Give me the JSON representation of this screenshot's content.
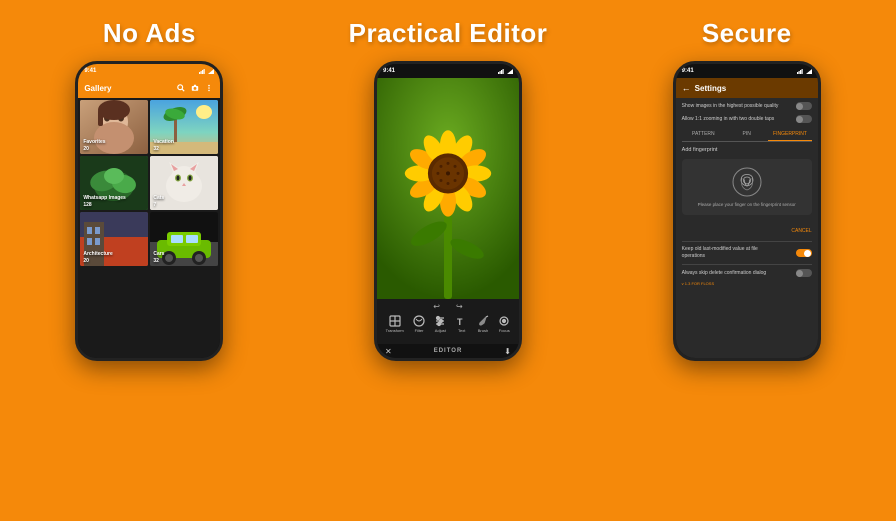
{
  "panels": [
    {
      "id": "no-ads",
      "title": "No Ads",
      "phone": {
        "time": "9:41",
        "app": "gallery",
        "toolbar": {
          "title": "Gallery"
        },
        "cells": [
          {
            "label": "Favorites",
            "count": "20",
            "type": "face"
          },
          {
            "label": "Vacation",
            "count": "32",
            "type": "beach"
          },
          {
            "label": "Whatsapp Images",
            "count": "128",
            "type": "plant"
          },
          {
            "label": "Cats",
            "count": "7",
            "type": "cat"
          },
          {
            "label": "Architecture",
            "count": "20",
            "type": "arch"
          },
          {
            "label": "Cars",
            "count": "32",
            "type": "car"
          }
        ]
      }
    },
    {
      "id": "practical-editor",
      "title": "Practical Editor",
      "phone": {
        "time": "9:41",
        "tools": [
          "Transform",
          "Filter",
          "Adjust",
          "Text",
          "Brush",
          "Focus"
        ],
        "label": "EDITOR"
      }
    },
    {
      "id": "secure",
      "title": "Secure",
      "phone": {
        "time": "9:41",
        "toolbar_title": "Settings",
        "setting1": "Show images in the highest possible quality",
        "setting2": "Allow 1:1 zooming in with two double taps",
        "tabs": [
          "PATTERN",
          "PIN",
          "FINGERPRINT"
        ],
        "active_tab": "FINGERPRINT",
        "add_fingerprint": "Add fingerprint",
        "fingerprint_prompt": "Please place your finger on the fingerprint sensor",
        "cancel": "CANCEL",
        "setting3": "Keep old last-modified value at file operations",
        "setting4": "Always skip delete confirmation dialog",
        "version": "v 1.3 FOR FLOSS"
      }
    }
  ]
}
